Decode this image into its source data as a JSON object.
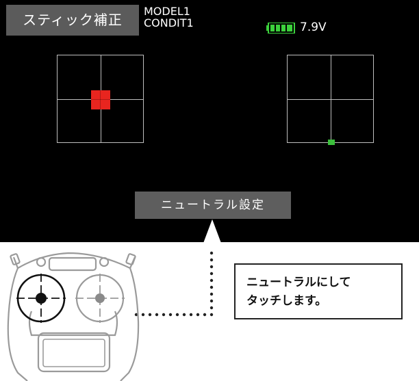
{
  "header": {
    "title": "スティック補正",
    "model": "MODEL1",
    "condition": "CONDIT1",
    "battery_voltage": "7.9V",
    "battery_level": 1.0,
    "battery_color": "#3cd13c"
  },
  "neutral_button": {
    "label": "ニュートラル設定"
  },
  "callout": {
    "line1": "ニュートラルにして",
    "line2": "タッチします。"
  },
  "colors": {
    "screen_bg": "#000000",
    "left_marker": "#e8251f",
    "right_marker": "#3cbf3c"
  },
  "icons": {
    "transmitter": "transmitter-outline-icon",
    "arrow": "up-arrow-icon"
  }
}
